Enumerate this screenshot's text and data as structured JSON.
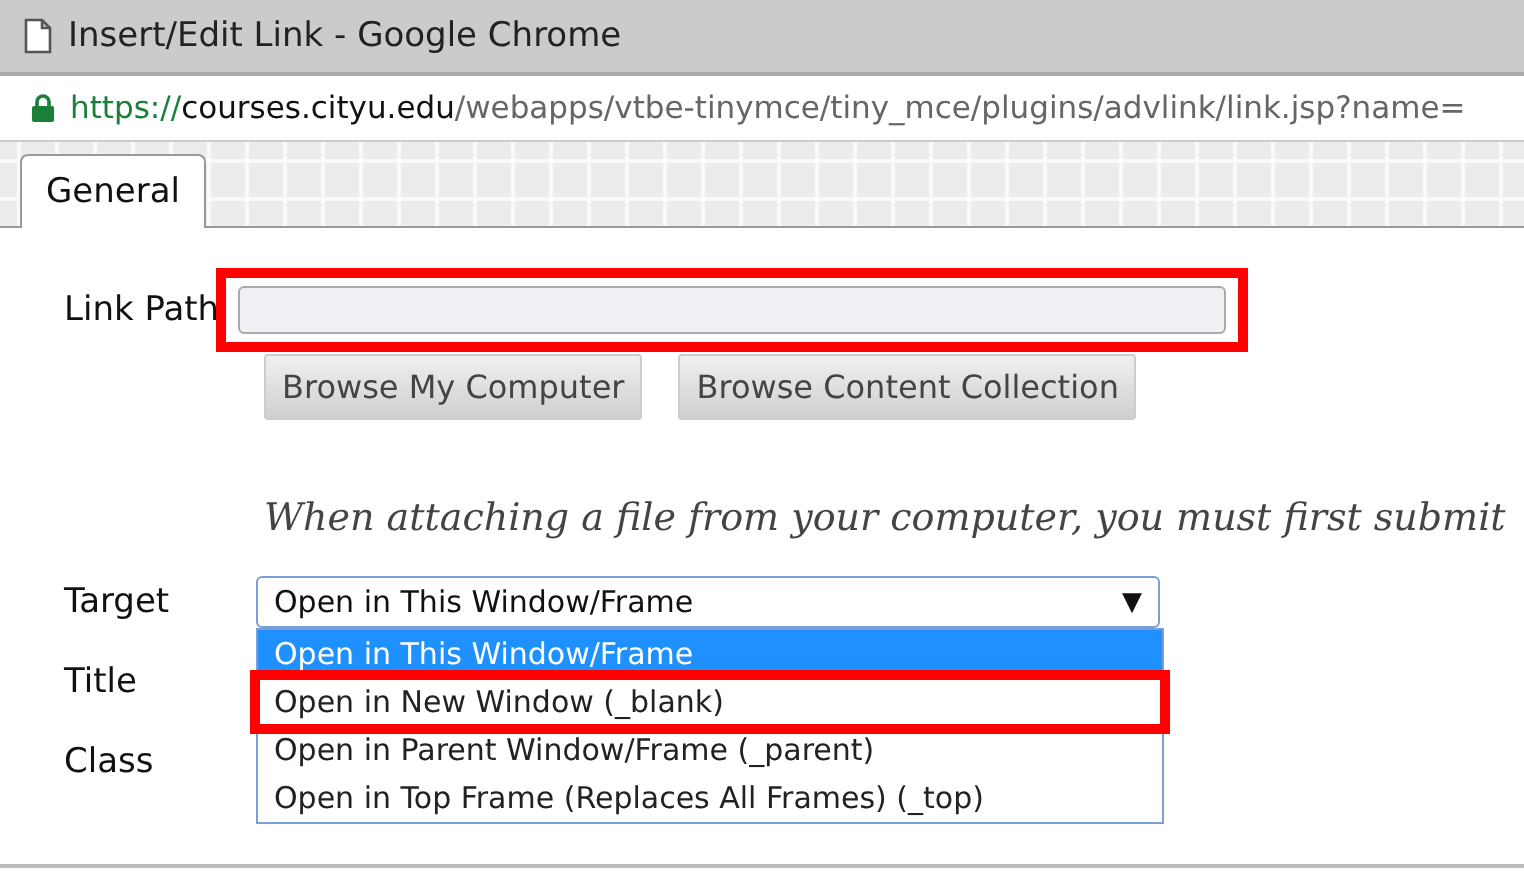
{
  "window": {
    "title": "Insert/Edit Link - Google Chrome"
  },
  "address_bar": {
    "secure": true,
    "scheme": "https://",
    "host": "courses.cityu.edu",
    "path": "/webapps/vtbe-tinymce/tiny_mce/plugins/advlink/link.jsp?name="
  },
  "tabs": [
    {
      "label": "General",
      "selected": true
    }
  ],
  "link_path": {
    "label": "Link Path",
    "highlighted": true
  },
  "buttons": [
    "Browse My Computer",
    "Browse Content Collection"
  ],
  "note": "When attaching a file from your computer, you must first submit",
  "target": {
    "label": "Target",
    "value": "Open in This Window/Frame",
    "caret": "▼",
    "expanded": true,
    "options": [
      {
        "label": "Open in This Window/Frame",
        "selected": true,
        "highlighted": false
      },
      {
        "label": "Open in New Window (_blank)",
        "selected": false,
        "highlighted": true
      },
      {
        "label": "Open in Parent Window/Frame (_parent)",
        "selected": false,
        "highlighted": false
      },
      {
        "label": "Open in Top Frame (Replaces All Frames) (_top)",
        "selected": false,
        "highlighted": false
      }
    ]
  },
  "fields": [
    {
      "label": "Title"
    },
    {
      "label": "Class"
    }
  ]
}
